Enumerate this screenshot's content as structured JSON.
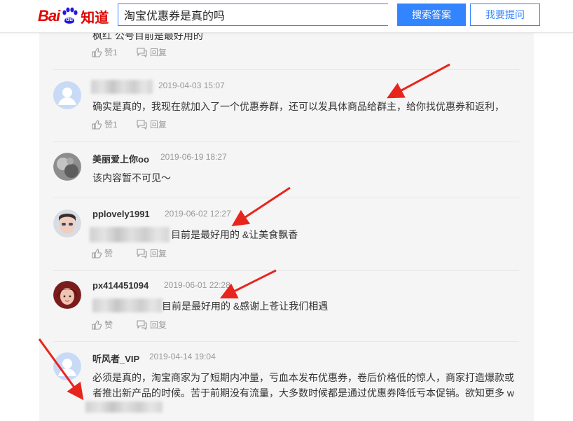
{
  "header": {
    "logo_text_latin": "Bai",
    "logo_paw_text": "du",
    "logo_text_cn": "知道",
    "search_value": "淘宝优惠券是真的吗",
    "search_button": "搜索答案",
    "ask_button": "我要提问"
  },
  "comments": [
    {
      "content": "枫红 公号目前是最好用的",
      "like": "赞1",
      "reply": "回复"
    },
    {
      "timestamp": "2019-04-03 15:07",
      "content": "确实是真的，我现在就加入了一个优惠券群，还可以发具体商品给群主，给你找优惠券和返利，",
      "like": "赞1",
      "reply": "回复"
    },
    {
      "username": "美丽爱上你oo",
      "timestamp": "2019-06-19 18:27",
      "content": "该内容暂不可见～"
    },
    {
      "username": "pplovely1991",
      "timestamp": "2019-06-02 12:27",
      "content": "目前是最好用的 &让美食飘香",
      "like": "赞",
      "reply": "回复"
    },
    {
      "username": "px414451094",
      "timestamp": "2019-06-01 22:28",
      "content": "目前是最好用的 &感谢上苍让我们相遇",
      "like": "赞",
      "reply": "回复"
    },
    {
      "username": "听风者_VIP",
      "timestamp": "2019-04-14 19:04",
      "content_line1": "必须是真的，淘宝商家为了短期内冲量，亏血本发布优惠券，卷后价格低的惊人，商家打造爆款或",
      "content_line2": "者推出新产品的时候。苦于前期没有流量，大多数时候都是通过优惠券降低亏本促销。欲知更多 w"
    }
  ],
  "colors": {
    "brand_red": "#e10601",
    "brand_blue": "#3385ff",
    "annotation_arrow": "#e8251c"
  }
}
